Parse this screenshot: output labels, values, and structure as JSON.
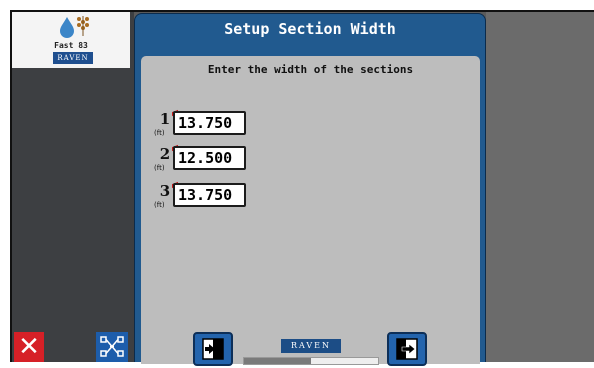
{
  "colors": {
    "dialog_blue": "#215a8f",
    "body_gray": "#bdbdbd",
    "close_red": "#d62027",
    "button_blue": "#2364ad"
  },
  "app_tile": {
    "name": "Fast 83",
    "badge": "RAVEN",
    "icon": "water-drop-and-grain-icon"
  },
  "dialog": {
    "title": "Setup Section Width",
    "instruction": "Enter the width of the sections",
    "sections": [
      {
        "number": "1",
        "unit": "(ft)",
        "value": "13.750"
      },
      {
        "number": "2",
        "unit": "(ft)",
        "value": "12.500"
      },
      {
        "number": "3",
        "unit": "(ft)",
        "value": "13.750"
      }
    ]
  },
  "footer": {
    "back_icon": "previous-page-icon",
    "next_icon": "next-page-icon",
    "logo": "RAVEN",
    "progress_fraction": 0.5
  },
  "bottom_left": {
    "close_icon": "close-icon",
    "close_glyph": "✕",
    "network_icon": "network-diagram-icon"
  }
}
